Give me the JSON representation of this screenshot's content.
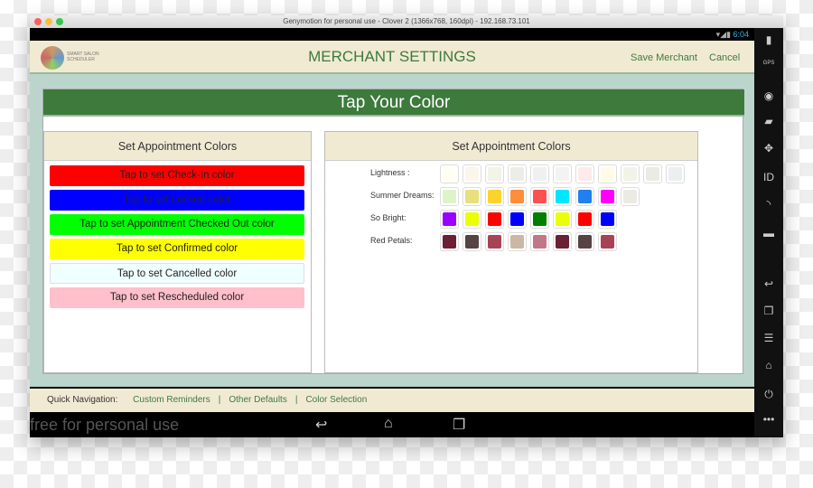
{
  "window": {
    "title": "Genymotion for personal use - Clover 2 (1366x768, 160dpi) - 192.168.73.101"
  },
  "status": {
    "time": "6:04"
  },
  "header": {
    "logo_text": "SMART SALON SCHEDULER",
    "title": "MERCHANT SETTINGS",
    "save_label": "Save Merchant",
    "cancel_label": "Cancel"
  },
  "banner": {
    "title": "Tap Your Color"
  },
  "left_panel": {
    "title": "Set Appointment Colors",
    "buttons": [
      {
        "label": "Tap to set Check-In color",
        "color": "#ff0000"
      },
      {
        "label": "Tap to set Locked color",
        "color": "#0000ff"
      },
      {
        "label": "Tap to set Appointment Checked Out color",
        "color": "#00ff00"
      },
      {
        "label": "Tap to set Confirmed color",
        "color": "#ffff00"
      },
      {
        "label": "Tap to set Cancelled color",
        "color": "#f0ffff"
      },
      {
        "label": "Tap to set Rescheduled color",
        "color": "#ffc0cb"
      }
    ]
  },
  "right_panel": {
    "title": "Set Appointment Colors",
    "palettes": [
      {
        "label": "Lightness :",
        "colors": [
          "#fffff4",
          "#fbf6ea",
          "#f1f4e6",
          "#ebede6",
          "#eef1f0",
          "#f3f3f3",
          "#fdeaea",
          "#fffbe6",
          "#f1f3e6",
          "#e9ebe4",
          "#eceff0"
        ]
      },
      {
        "label": "Summer Dreams:",
        "colors": [
          "#dff3c8",
          "#e8e07a",
          "#fdd22e",
          "#fe8e3a",
          "#ff5050",
          "#00e6ff",
          "#2080f0",
          "#ff00ff",
          "#ebebe4"
        ]
      },
      {
        "label": "So Bright:",
        "colors": [
          "#9900ff",
          "#eaff00",
          "#ff0000",
          "#0000ff",
          "#008000",
          "#eaff00",
          "#ff0000",
          "#0000ff"
        ]
      },
      {
        "label": "Red Petals:",
        "colors": [
          "#6a2035",
          "#564343",
          "#a64456",
          "#ccb7a5",
          "#c07888",
          "#6a2035",
          "#564343",
          "#a64456"
        ]
      }
    ]
  },
  "footer": {
    "label": "Quick Navigation:",
    "links": [
      "Custom Reminders",
      "Other Defaults",
      "Color Selection"
    ]
  },
  "watermark": "free for personal use",
  "sidebar_icons": [
    "battery-icon",
    "gps-icon",
    "camera-icon",
    "clapper-icon",
    "dpad-icon",
    "id-icon",
    "rss-icon",
    "sms-icon",
    "back-icon",
    "recent-apps-icon",
    "menu-icon",
    "home-icon",
    "power-icon",
    "more-icon"
  ]
}
